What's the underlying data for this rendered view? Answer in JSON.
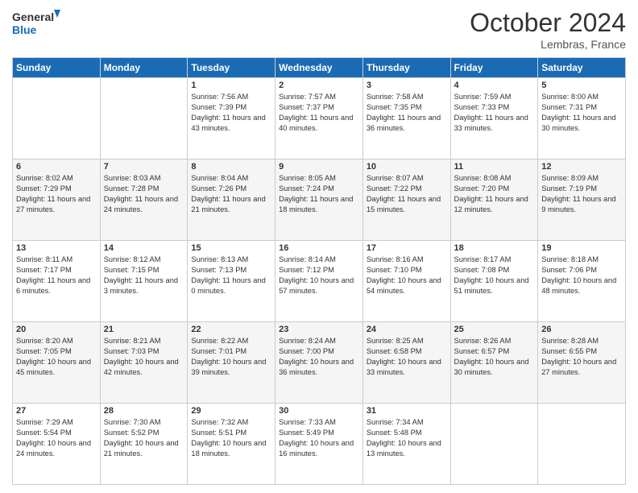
{
  "logo": {
    "line1": "General",
    "line2": "Blue"
  },
  "title": "October 2024",
  "location": "Lembras, France",
  "days_header": [
    "Sunday",
    "Monday",
    "Tuesday",
    "Wednesday",
    "Thursday",
    "Friday",
    "Saturday"
  ],
  "weeks": [
    [
      {
        "num": "",
        "info": ""
      },
      {
        "num": "",
        "info": ""
      },
      {
        "num": "1",
        "info": "Sunrise: 7:56 AM\nSunset: 7:39 PM\nDaylight: 11 hours and 43 minutes."
      },
      {
        "num": "2",
        "info": "Sunrise: 7:57 AM\nSunset: 7:37 PM\nDaylight: 11 hours and 40 minutes."
      },
      {
        "num": "3",
        "info": "Sunrise: 7:58 AM\nSunset: 7:35 PM\nDaylight: 11 hours and 36 minutes."
      },
      {
        "num": "4",
        "info": "Sunrise: 7:59 AM\nSunset: 7:33 PM\nDaylight: 11 hours and 33 minutes."
      },
      {
        "num": "5",
        "info": "Sunrise: 8:00 AM\nSunset: 7:31 PM\nDaylight: 11 hours and 30 minutes."
      }
    ],
    [
      {
        "num": "6",
        "info": "Sunrise: 8:02 AM\nSunset: 7:29 PM\nDaylight: 11 hours and 27 minutes."
      },
      {
        "num": "7",
        "info": "Sunrise: 8:03 AM\nSunset: 7:28 PM\nDaylight: 11 hours and 24 minutes."
      },
      {
        "num": "8",
        "info": "Sunrise: 8:04 AM\nSunset: 7:26 PM\nDaylight: 11 hours and 21 minutes."
      },
      {
        "num": "9",
        "info": "Sunrise: 8:05 AM\nSunset: 7:24 PM\nDaylight: 11 hours and 18 minutes."
      },
      {
        "num": "10",
        "info": "Sunrise: 8:07 AM\nSunset: 7:22 PM\nDaylight: 11 hours and 15 minutes."
      },
      {
        "num": "11",
        "info": "Sunrise: 8:08 AM\nSunset: 7:20 PM\nDaylight: 11 hours and 12 minutes."
      },
      {
        "num": "12",
        "info": "Sunrise: 8:09 AM\nSunset: 7:19 PM\nDaylight: 11 hours and 9 minutes."
      }
    ],
    [
      {
        "num": "13",
        "info": "Sunrise: 8:11 AM\nSunset: 7:17 PM\nDaylight: 11 hours and 6 minutes."
      },
      {
        "num": "14",
        "info": "Sunrise: 8:12 AM\nSunset: 7:15 PM\nDaylight: 11 hours and 3 minutes."
      },
      {
        "num": "15",
        "info": "Sunrise: 8:13 AM\nSunset: 7:13 PM\nDaylight: 11 hours and 0 minutes."
      },
      {
        "num": "16",
        "info": "Sunrise: 8:14 AM\nSunset: 7:12 PM\nDaylight: 10 hours and 57 minutes."
      },
      {
        "num": "17",
        "info": "Sunrise: 8:16 AM\nSunset: 7:10 PM\nDaylight: 10 hours and 54 minutes."
      },
      {
        "num": "18",
        "info": "Sunrise: 8:17 AM\nSunset: 7:08 PM\nDaylight: 10 hours and 51 minutes."
      },
      {
        "num": "19",
        "info": "Sunrise: 8:18 AM\nSunset: 7:06 PM\nDaylight: 10 hours and 48 minutes."
      }
    ],
    [
      {
        "num": "20",
        "info": "Sunrise: 8:20 AM\nSunset: 7:05 PM\nDaylight: 10 hours and 45 minutes."
      },
      {
        "num": "21",
        "info": "Sunrise: 8:21 AM\nSunset: 7:03 PM\nDaylight: 10 hours and 42 minutes."
      },
      {
        "num": "22",
        "info": "Sunrise: 8:22 AM\nSunset: 7:01 PM\nDaylight: 10 hours and 39 minutes."
      },
      {
        "num": "23",
        "info": "Sunrise: 8:24 AM\nSunset: 7:00 PM\nDaylight: 10 hours and 36 minutes."
      },
      {
        "num": "24",
        "info": "Sunrise: 8:25 AM\nSunset: 6:58 PM\nDaylight: 10 hours and 33 minutes."
      },
      {
        "num": "25",
        "info": "Sunrise: 8:26 AM\nSunset: 6:57 PM\nDaylight: 10 hours and 30 minutes."
      },
      {
        "num": "26",
        "info": "Sunrise: 8:28 AM\nSunset: 6:55 PM\nDaylight: 10 hours and 27 minutes."
      }
    ],
    [
      {
        "num": "27",
        "info": "Sunrise: 7:29 AM\nSunset: 5:54 PM\nDaylight: 10 hours and 24 minutes."
      },
      {
        "num": "28",
        "info": "Sunrise: 7:30 AM\nSunset: 5:52 PM\nDaylight: 10 hours and 21 minutes."
      },
      {
        "num": "29",
        "info": "Sunrise: 7:32 AM\nSunset: 5:51 PM\nDaylight: 10 hours and 18 minutes."
      },
      {
        "num": "30",
        "info": "Sunrise: 7:33 AM\nSunset: 5:49 PM\nDaylight: 10 hours and 16 minutes."
      },
      {
        "num": "31",
        "info": "Sunrise: 7:34 AM\nSunset: 5:48 PM\nDaylight: 10 hours and 13 minutes."
      },
      {
        "num": "",
        "info": ""
      },
      {
        "num": "",
        "info": ""
      }
    ]
  ]
}
